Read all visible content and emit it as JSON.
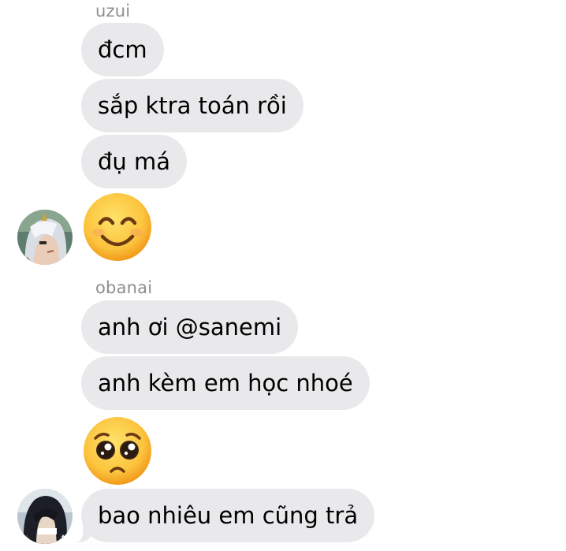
{
  "messages_group_1": {
    "sender": "uzui",
    "bubbles": [
      "đcm",
      "sắp ktra toán rồi",
      "đụ má"
    ],
    "emoji": "smiling-face-with-smiling-eyes",
    "avatar": "silver-haired-character-avatar"
  },
  "messages_group_2": {
    "sender": "obanai",
    "bubbles": [
      "anh ơi @sanemi",
      "anh kèm em học nhoé",
      "bao nhiêu em cũng trả"
    ],
    "emoji": "pleading-face",
    "avatar": "dark-haired-character-avatar"
  },
  "colors": {
    "bubble": "#e9e9eb",
    "sender_label": "#8e8e93",
    "emoji_yellow": "#fcc43e"
  }
}
